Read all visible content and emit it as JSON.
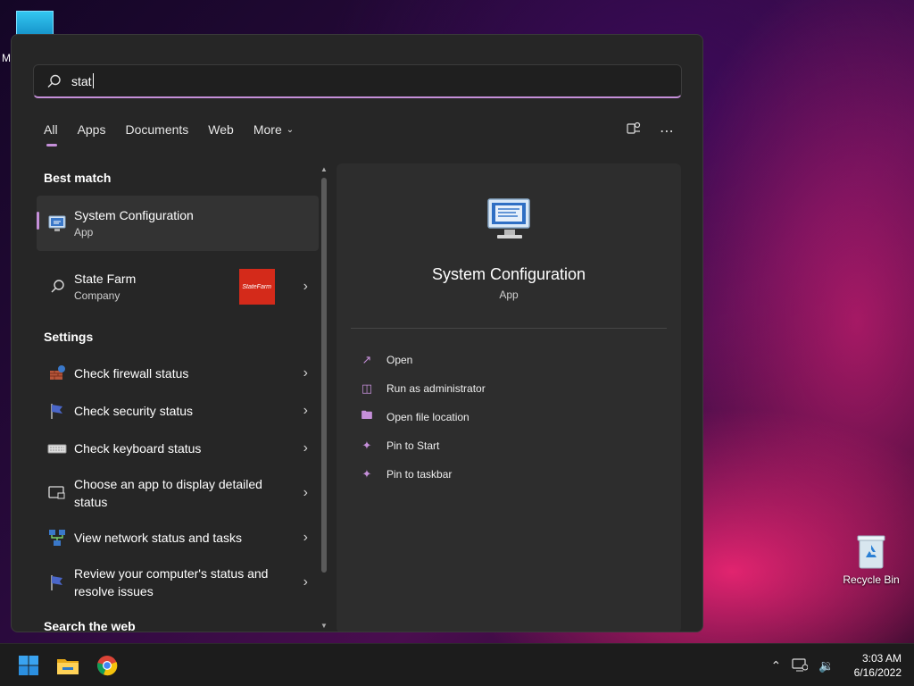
{
  "desktop": {
    "top_letter": "M",
    "recycle_bin_label": "Recycle Bin"
  },
  "search": {
    "value": "stat",
    "icon": "search-icon"
  },
  "tabs": [
    {
      "label": "All",
      "active": true
    },
    {
      "label": "Apps",
      "active": false
    },
    {
      "label": "Documents",
      "active": false
    },
    {
      "label": "Web",
      "active": false
    },
    {
      "label": "More",
      "active": false
    }
  ],
  "top_right_icons": [
    "share-icon",
    "more-options-icon"
  ],
  "left": {
    "best_match_header": "Best match",
    "best_match": {
      "title": "System Configuration",
      "subtitle": "App",
      "icon": "system-config-icon"
    },
    "company": {
      "title": "State Farm",
      "subtitle": "Company",
      "thumb_text": "StateFarm",
      "icon": "search-icon"
    },
    "settings_header": "Settings",
    "settings": [
      {
        "text": "Check firewall status",
        "icon": "firewall-icon"
      },
      {
        "text": "Check security status",
        "icon": "flag-icon"
      },
      {
        "text": "Check keyboard status",
        "icon": "keyboard-icon"
      },
      {
        "text": "Choose an app to display detailed status",
        "icon": "lock-screen-icon"
      },
      {
        "text": "View network status and tasks",
        "icon": "network-icon"
      },
      {
        "text": "Review your computer's status and resolve issues",
        "icon": "flag-icon"
      }
    ],
    "web_header": "Search the web"
  },
  "details": {
    "title": "System Configuration",
    "type": "App",
    "actions": [
      {
        "label": "Open",
        "icon": "open-icon"
      },
      {
        "label": "Run as administrator",
        "icon": "shield-icon"
      },
      {
        "label": "Open file location",
        "icon": "folder-icon"
      },
      {
        "label": "Pin to Start",
        "icon": "pin-icon"
      },
      {
        "label": "Pin to taskbar",
        "icon": "pin-icon"
      }
    ]
  },
  "taskbar": {
    "apps": [
      "windows-start-icon",
      "file-explorer-icon",
      "chrome-icon"
    ],
    "time": "3:03 AM",
    "date": "6/16/2022",
    "accent": "#c58fd9"
  }
}
